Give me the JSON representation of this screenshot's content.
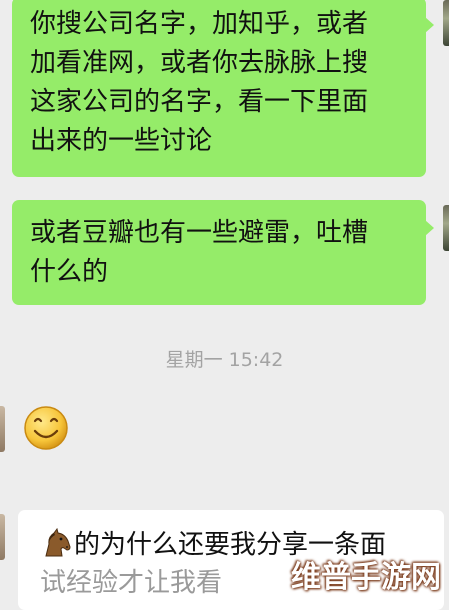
{
  "messages": [
    {
      "direction": "sent",
      "lines": [
        "你搜公司名字，加知乎，或者",
        "加看准网，或者你去脉脉上搜",
        "这家公司的名字，看一下里面",
        "出来的一些讨论"
      ]
    },
    {
      "direction": "sent",
      "lines": [
        "或者豆瓣也有一些避雷，吐槽",
        "什么的"
      ]
    },
    {
      "direction": "received",
      "type": "emoji",
      "icon": "smiley-face-icon"
    },
    {
      "direction": "received",
      "icon": "horse-icon",
      "lines": [
        "的为什么还要我分享一条面",
        "试经验才让我看"
      ]
    }
  ],
  "timestamp": "星期一 15:42",
  "watermark": "维普手游网",
  "colors": {
    "background": "#ededed",
    "sent_bubble": "#95ec69",
    "received_bubble": "#ffffff",
    "timestamp": "#a3a3a3"
  }
}
